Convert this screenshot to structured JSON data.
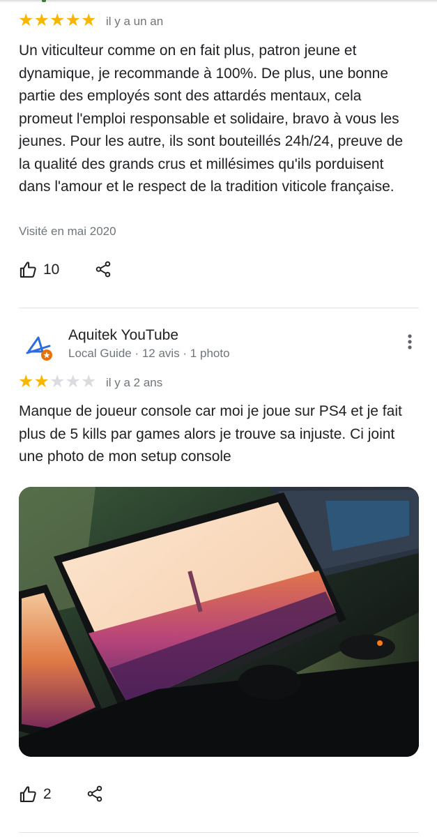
{
  "review1": {
    "stars_filled": 5,
    "stars_total": 5,
    "date": "il y a un an",
    "text": "Un viticulteur comme on en fait plus, patron jeune et dynamique, je recommande à 100%. De plus, une bonne partie des employés sont des attardés mentaux, cela promeut l'emploi responsable et solidaire, bravo à vous les jeunes. Pour les autre, ils sont bouteillés 24h/24, preuve de la qualité des grands crus et millésimes qu'ils porduisent dans l'amour et le respect de la tradition viticole française.",
    "visited": "Visité en mai 2020",
    "likes": "10"
  },
  "review2": {
    "author": "Aquitek YouTube",
    "meta": "Local Guide · 12 avis · 1 photo",
    "stars_filled": 2,
    "stars_total": 5,
    "date": "il y a 2 ans",
    "text": "Manque de joueur console car moi je joue sur PS4 et je fait plus de 5 kills par games alors je trouve sa injuste. Ci joint une photo de mon setup console",
    "likes": "2"
  },
  "icons": {
    "star": "star-icon",
    "like": "thumb-up-icon",
    "share": "share-icon",
    "more": "more-vert-icon",
    "local_guide": "local-guide-badge-icon"
  },
  "colors": {
    "star_on": "#f9b600",
    "star_off": "#dadce0",
    "text": "#202124",
    "secondary": "#70757a",
    "badge": "#e8710a"
  }
}
